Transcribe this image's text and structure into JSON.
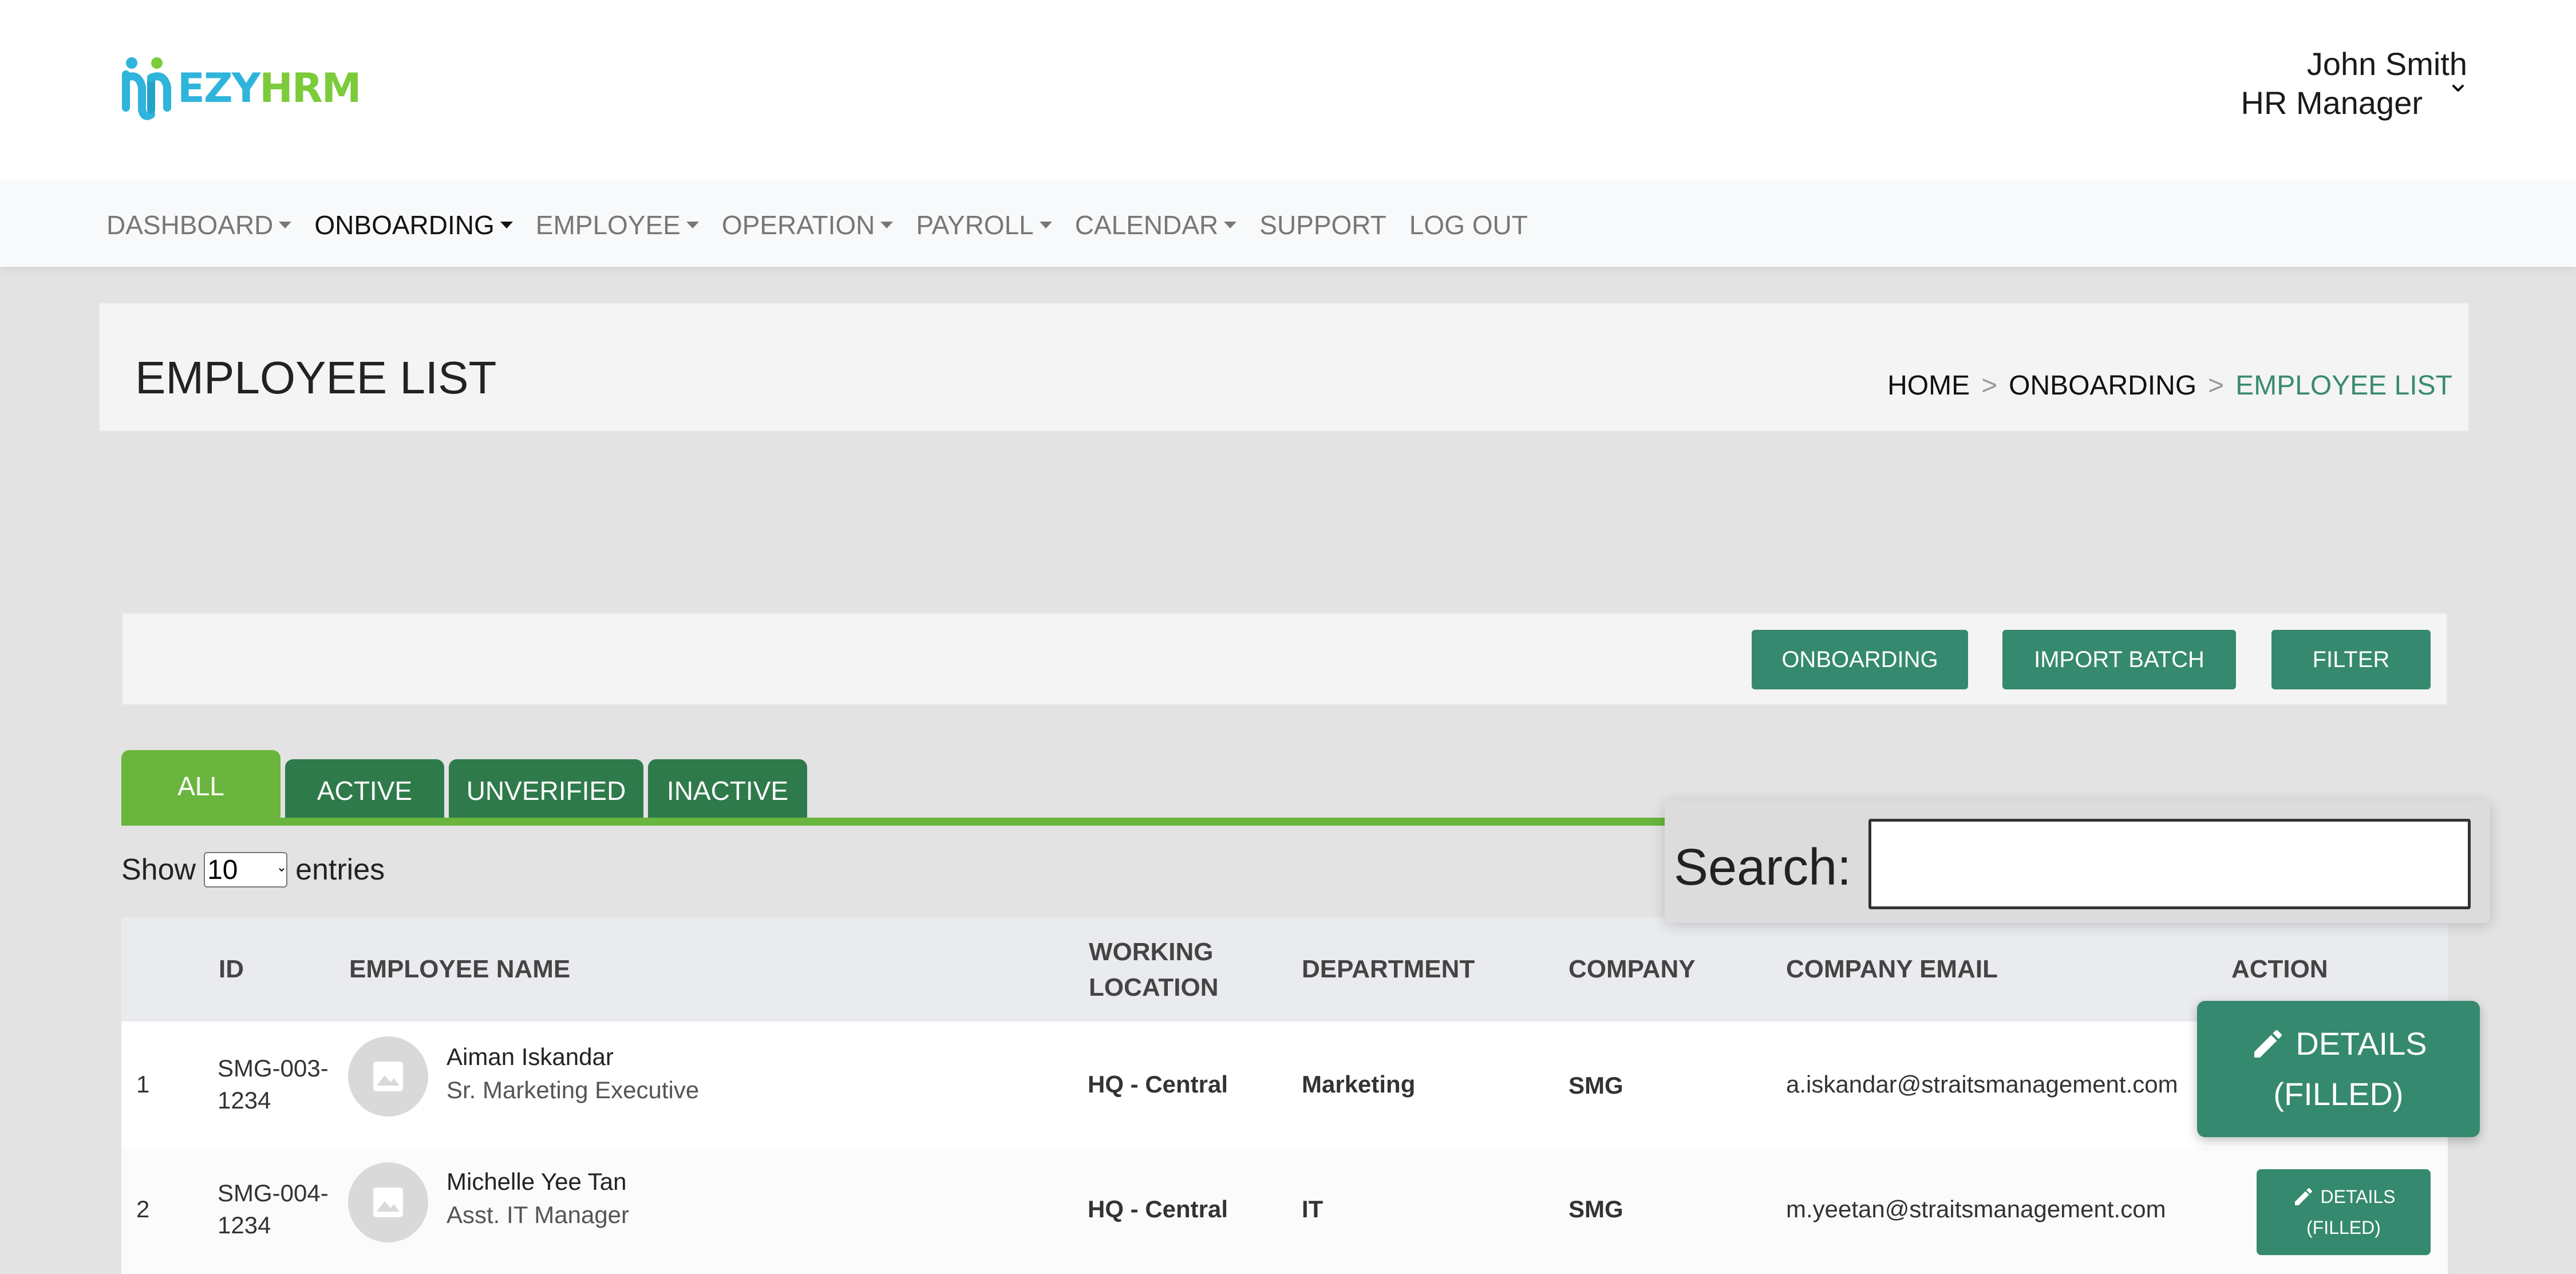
{
  "brand": {
    "part1": "EZY",
    "part2": "HRM",
    "color_blue": "#2fb4dc",
    "color_green": "#7ccb3b"
  },
  "user": {
    "name": "John Smith",
    "role": "HR Manager",
    "menu_icon": "chevron-down-icon"
  },
  "nav": [
    {
      "label": "DASHBOARD",
      "dropdown": true
    },
    {
      "label": "ONBOARDING",
      "dropdown": true,
      "active": true
    },
    {
      "label": "EMPLOYEE",
      "dropdown": true
    },
    {
      "label": "OPERATION",
      "dropdown": true
    },
    {
      "label": "PAYROLL",
      "dropdown": true
    },
    {
      "label": "CALENDAR",
      "dropdown": true
    },
    {
      "label": "SUPPORT",
      "dropdown": false
    },
    {
      "label": "LOG OUT",
      "dropdown": false
    }
  ],
  "page": {
    "title": "EMPLOYEE LIST",
    "breadcrumb": [
      "HOME",
      "ONBOARDING",
      "EMPLOYEE LIST"
    ],
    "breadcrumb_sep": ">"
  },
  "toolbar": {
    "onboarding": "ONBOARDING",
    "import_batch": "IMPORT BATCH",
    "filter": "FILTER"
  },
  "tabs": [
    "ALL",
    "ACTIVE",
    "UNVERIFIED",
    "INACTIVE"
  ],
  "entries": {
    "show": "Show",
    "value": "10",
    "suffix": "entries"
  },
  "search": {
    "label": "Search:",
    "value": ""
  },
  "table": {
    "headers": {
      "id": "ID",
      "name": "EMPLOYEE NAME",
      "location_1": "WORKING",
      "location_2": "LOCATION",
      "department": "DEPARTMENT",
      "company": "COMPANY",
      "email": "COMPANY EMAIL",
      "action": "ACTION"
    },
    "rows": [
      {
        "no": "1",
        "id_1": "SMG-003-",
        "id_2": "1234",
        "name": "Aiman Iskandar",
        "role": "Sr. Marketing Executive",
        "location": "HQ - Central",
        "department": "Marketing",
        "company": "SMG",
        "email": "a.iskandar@straitsmanagement.com",
        "action_1": "DETAILS",
        "action_2": "(FILLED)"
      },
      {
        "no": "2",
        "id_1": "SMG-004-",
        "id_2": "1234",
        "name": "Michelle Yee Tan",
        "role": "Asst. IT Manager",
        "location": "HQ - Central",
        "department": "IT",
        "company": "SMG",
        "email": "m.yeetan@straitsmanagement.com",
        "action_1": "DETAILS",
        "action_2": "(FILLED)"
      }
    ]
  },
  "colors": {
    "primary": "#35896f",
    "tab_active": "#6ab53d",
    "tab": "#2f7a4b",
    "breadcrumb_current": "#3a8a6f"
  }
}
